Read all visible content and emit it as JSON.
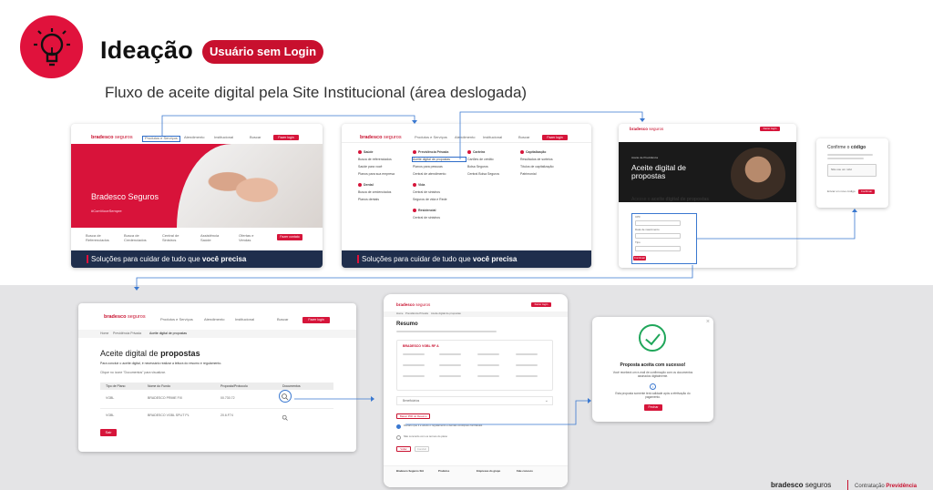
{
  "header": {
    "title": "Ideação",
    "badge": "Usuário sem Login",
    "subtitle": "Fluxo de aceite digital pela Site Institucional (área deslogada)",
    "icon": "lightbulb-icon",
    "accent": "#e0123c"
  },
  "site": {
    "brand": "bradesco",
    "brand_suffix": "seguros",
    "products_menu": "Produtos e Serviços",
    "attendance_menu": "Atendimento",
    "institutional_menu": "Institucional",
    "search_label": "Buscar",
    "login_button": "Fazer login",
    "footer_tagline_prefix": "Soluções para cuidar de tudo que",
    "footer_tagline_bold": "você precisa"
  },
  "screen1": {
    "hero_title": "Bradesco Seguros",
    "hero_tag": "#ComVoceSempre",
    "quick_links": [
      "Busca de Referenciados",
      "Busca de Credenciados",
      "Central de Sinistros",
      "Assistência Saúde",
      "Ofertas e Vendas"
    ],
    "quick_button": "Fazer contato"
  },
  "screen2": {
    "menu_cols": [
      [
        "Saúde",
        "Busca de referenciados",
        "Saúde para você",
        "Planos para sua empresa"
      ],
      [
        "Previdência Privada",
        "Aceite digital de propostas",
        "Planos para pessoas",
        "Central de atendimento"
      ],
      [
        "Carteira",
        "Cartões de crédito",
        "Bolsa Seguros",
        "Central Bolsa Seguros"
      ],
      [
        "Capitalização",
        "Resultados de sorteios",
        "Títulos de capitalização",
        "Patrimonial"
      ]
    ],
    "extra_cols": [
      [
        "Dental",
        "Busca de credenciados",
        "Planos dentais"
      ],
      [
        "Vida",
        "Central de sinistros",
        "Seguros de vida e Rede"
      ],
      [
        "Residencial",
        "Central de sinistros"
      ]
    ]
  },
  "screen3": {
    "hero_kicker": "Aceite de Previdência",
    "hero_title": "Aceite digital de propostas",
    "section_prefix": "Acesse o",
    "section_bold": "aceite digital de propostas",
    "fields": [
      "CPF",
      "Data de nascimento",
      "Tipo"
    ],
    "submit": "Continuar"
  },
  "screen4": {
    "title_prefix": "Confirme o",
    "title_bold": "código",
    "captcha_label": "Não sou um robô",
    "resend_label": "Enviar um novo código",
    "submit": "Confirmar"
  },
  "screen5": {
    "breadcrumb": [
      "Home",
      "Previdência Privada",
      "Aceite digital de propostas"
    ],
    "title_prefix": "Aceite digital de",
    "title_bold": "propostas",
    "intro": "Para concluir o aceite digital, é necessário realizar a leitura do resumo e regulamento.",
    "hint": "Clique no ícone \"Documentos\" para visualizar.",
    "table_headers": [
      "Tipo de Plano",
      "Nome do Fundo",
      "Proposta/Protocolo",
      "Documentos"
    ],
    "rows": [
      [
        "VGBL",
        "BRADESCO PRIME FIX",
        "00.730.72"
      ],
      [
        "VGBL",
        "BRADESCO VGBL SPLIT PL",
        "20.6.F74"
      ]
    ],
    "submit": "Sair"
  },
  "screen6": {
    "breadcrumb": [
      "Home",
      "Previdência Privada",
      "Aceite digital de propostas"
    ],
    "title": "Resumo",
    "card_title": "BRADESCO VGBL RF A",
    "accordion": "Beneficiários",
    "download": "Baixar PDF do Resumo",
    "accept_text": "Declaro que li e aceito o regulamento e demais condições contratuais",
    "decline_text": "Não concordo com os termos do plano",
    "buttons": [
      "Voltar",
      "Concluir"
    ],
    "footer_cols": [
      "Bradesco Seguros S/A",
      "Produtos",
      "Empresas do grupo",
      "Fale conosco"
    ]
  },
  "modal": {
    "title": "Proposta aceita com sucesso!",
    "line1": "Você receberá um e-mail de confirmação com os documentos assinados digitalmente.",
    "line2": "Esta proposta somente terá validade após a efetivação do pagamento.",
    "button": "Fechar"
  },
  "corner": {
    "brand": "bradesco",
    "brand_suffix": "seguros",
    "right_prefix": "Contratação",
    "right_bold": "Previdência"
  }
}
